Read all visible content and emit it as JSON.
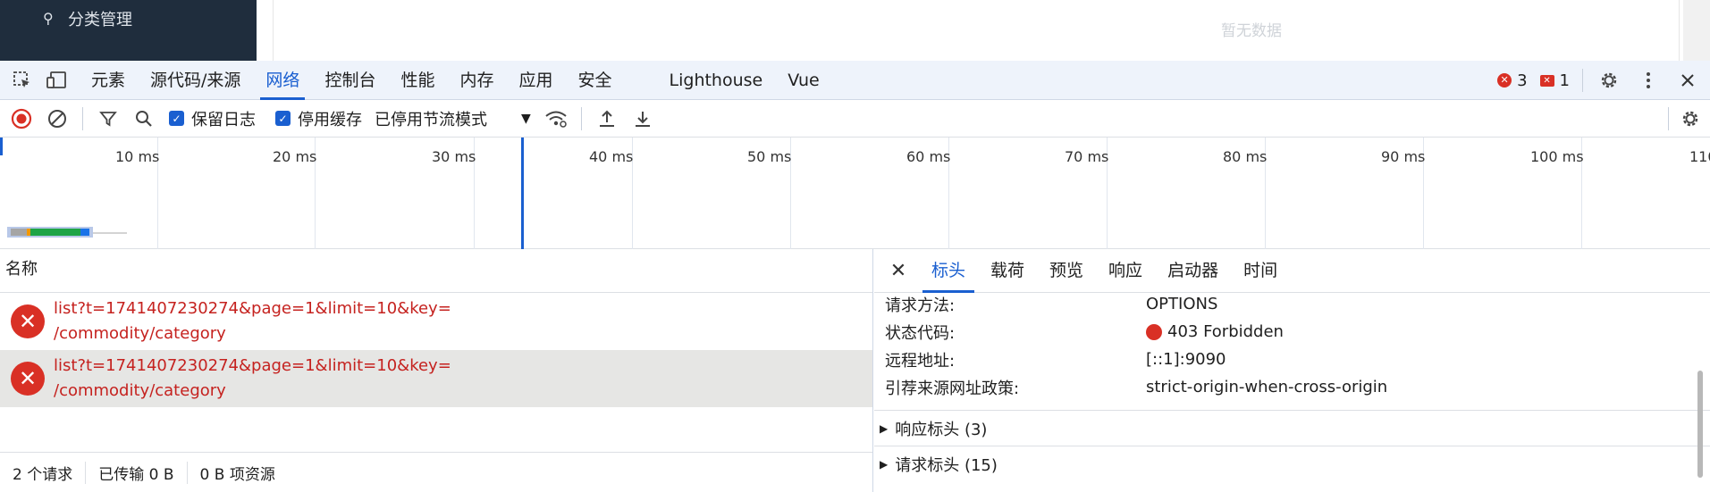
{
  "app": {
    "sidebar_item": "分类管理",
    "empty_text": "暂无数据"
  },
  "devtools": {
    "tabs": [
      "元素",
      "源代码/来源",
      "网络",
      "控制台",
      "性能",
      "内存",
      "应用",
      "安全",
      "Lighthouse",
      "Vue"
    ],
    "active_tab": "网络",
    "error_count": "3",
    "issue_count": "1",
    "toolbar": {
      "preserve_log": "保留日志",
      "disable_cache": "停用缓存",
      "throttling": "已停用节流模式"
    },
    "timeline_ticks": [
      "10 ms",
      "20 ms",
      "30 ms",
      "40 ms",
      "50 ms",
      "60 ms",
      "70 ms",
      "80 ms",
      "90 ms",
      "100 ms",
      "110"
    ],
    "list": {
      "header": "名称",
      "rows": [
        {
          "line1": "list?t=1741407230274&page=1&limit=10&key=",
          "line2": "/commodity/category"
        },
        {
          "line1": "list?t=1741407230274&page=1&limit=10&key=",
          "line2": "/commodity/category"
        }
      ],
      "status": [
        "2 个请求",
        "已传输 0 B",
        "0 B 项资源"
      ]
    },
    "details": {
      "tabs": [
        "标头",
        "载荷",
        "预览",
        "响应",
        "启动器",
        "时间"
      ],
      "active_tab": "标头",
      "general": [
        {
          "key": "请求方法:",
          "value": "OPTIONS"
        },
        {
          "key": "状态代码:",
          "value": "403 Forbidden"
        },
        {
          "key": "远程地址:",
          "value": "[::1]:9090"
        },
        {
          "key": "引荐来源网址政策:",
          "value": "strict-origin-when-cross-origin"
        }
      ],
      "response_headers": "响应标头 (3)",
      "request_headers": "请求标头 (15)"
    },
    "colors": {
      "accent": "#1a5fd0",
      "error": "#d93025"
    }
  }
}
